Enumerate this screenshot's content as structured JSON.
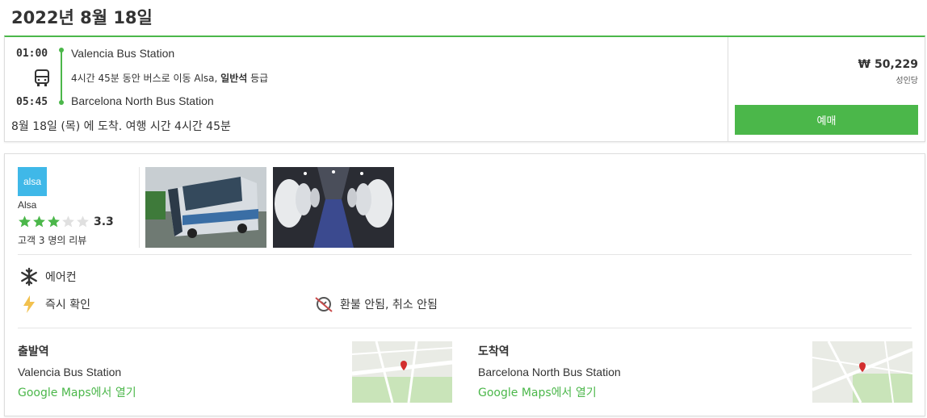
{
  "header": {
    "date": "2022년 8월 18일"
  },
  "trip": {
    "departure_time": "01:00",
    "arrival_time": "05:45",
    "departure_station": "Valencia Bus Station",
    "arrival_station": "Barcelona North Bus Station",
    "ride_prefix": "4시간 45분 동안 버스로 이동 Alsa,",
    "ride_class": "일반석",
    "ride_suffix": "등급",
    "arrival_note": "8월 18일 (목) 에 도착. 여행 시간 4시간 45분",
    "price": "₩ 50,229",
    "per_adult": "성인당",
    "book_label": "예매"
  },
  "operator": {
    "logo_text": "alsa",
    "name": "Alsa",
    "rating_value": 3.3,
    "rating": "3.3",
    "reviews": "고객 3 명의 리뷰"
  },
  "amenities": {
    "ac": "에어컨",
    "instant": "즉시 확인",
    "refund": "환불 안됨, 취소 안됨"
  },
  "stops": {
    "from_label": "출발역",
    "from_name": "Valencia Bus Station",
    "from_link": "Google Maps에서 열기",
    "to_label": "도착역",
    "to_name": "Barcelona North Bus Station",
    "to_link": "Google Maps에서 열기"
  },
  "colors": {
    "accent": "#4bb74a",
    "logo": "#3fb8e8",
    "star": "#4bb74a"
  }
}
